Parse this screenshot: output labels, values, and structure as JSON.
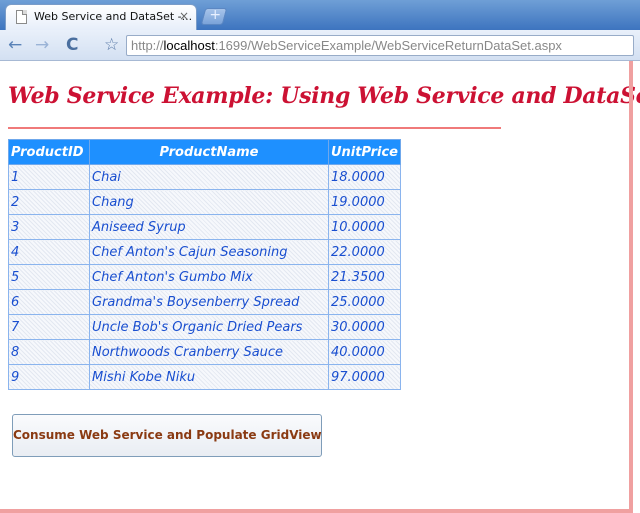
{
  "browser": {
    "tab_title": "Web Service and DataSet -...",
    "tab_close": "×",
    "new_tab": "+",
    "back": "←",
    "forward": "→",
    "reload": "C",
    "star": "☆",
    "url_scheme": "http://",
    "url_host": "localhost",
    "url_rest": ":1699/WebServiceExample/WebServiceReturnDataSet.aspx"
  },
  "page": {
    "title": "Web Service Example: Using Web Service and DataSet",
    "button_label": "Consume Web Service and Populate GridView"
  },
  "grid": {
    "headers": [
      "ProductID",
      "ProductName",
      "UnitPrice"
    ],
    "rows": [
      [
        "1",
        "Chai",
        "18.0000"
      ],
      [
        "2",
        "Chang",
        "19.0000"
      ],
      [
        "3",
        "Aniseed Syrup",
        "10.0000"
      ],
      [
        "4",
        "Chef Anton's Cajun Seasoning",
        "22.0000"
      ],
      [
        "5",
        "Chef Anton's Gumbo Mix",
        "21.3500"
      ],
      [
        "6",
        "Grandma's Boysenberry Spread",
        "25.0000"
      ],
      [
        "7",
        "Uncle Bob's Organic Dried Pears",
        "30.0000"
      ],
      [
        "8",
        "Northwoods Cranberry Sauce",
        "40.0000"
      ],
      [
        "9",
        "Mishi Kobe Niku",
        "97.0000"
      ]
    ]
  },
  "colors": {
    "title": "#cc1133",
    "header_bg": "#1e90ff",
    "cell_text": "#1a4fd0",
    "button_text": "#8a3a12"
  }
}
